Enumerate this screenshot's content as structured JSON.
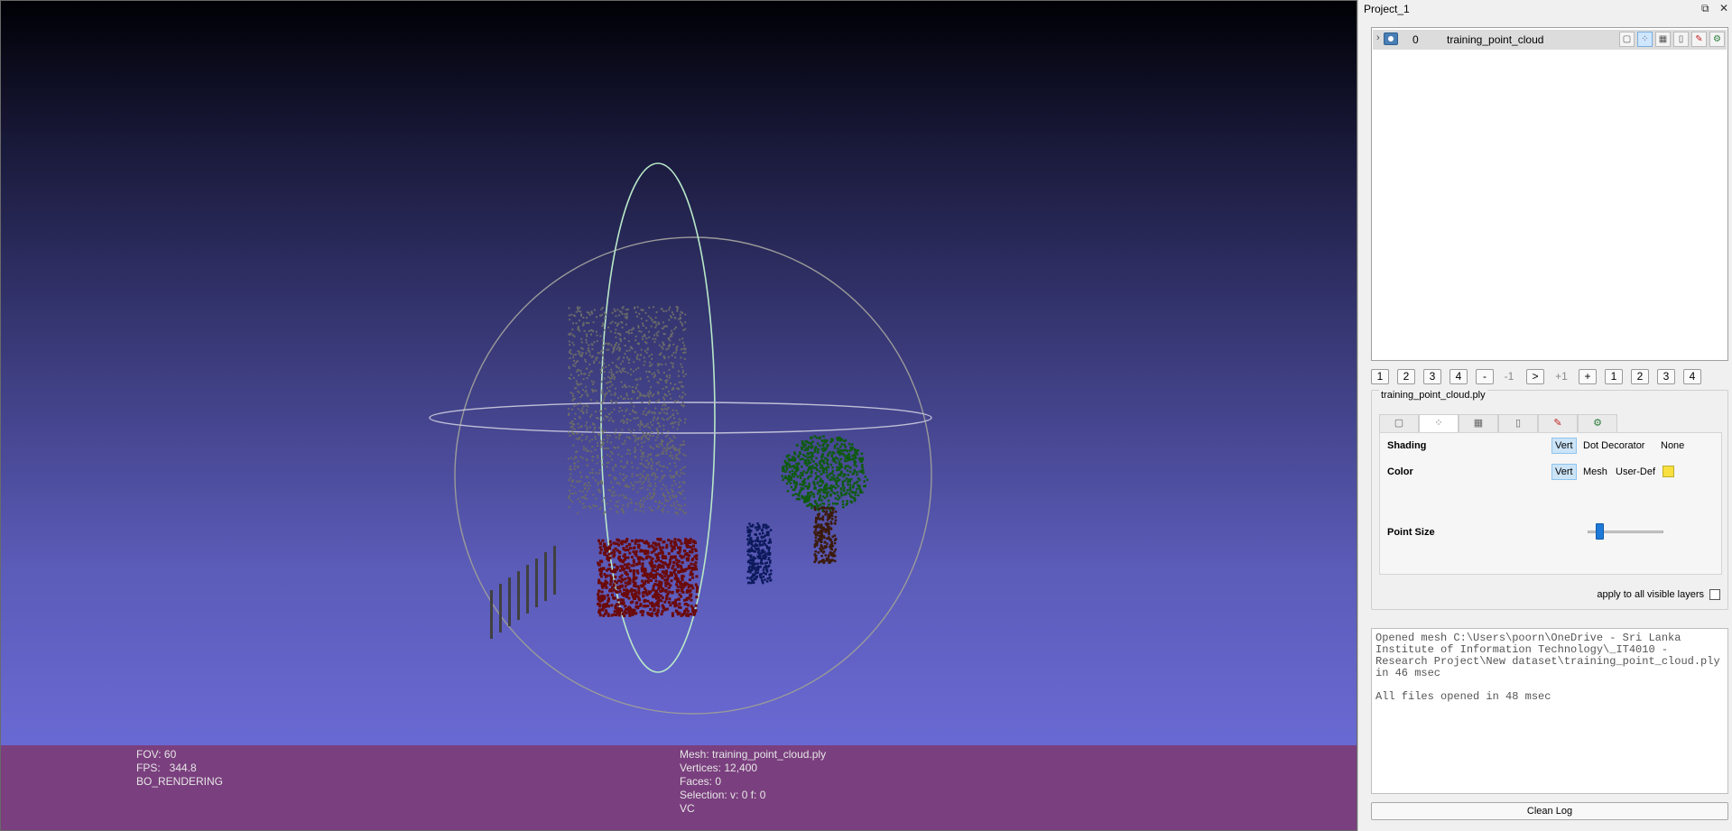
{
  "viewport": {
    "left_info": {
      "fov": "FOV: 60",
      "fps": "FPS:   344.8",
      "mode": "BO_RENDERING"
    },
    "right_info": {
      "mesh": "Mesh: training_point_cloud.ply",
      "vertices": "Vertices: 12,400",
      "faces": "Faces: 0",
      "selection": "Selection: v: 0 f: 0",
      "vc": "VC"
    },
    "colors": {
      "grey_cloud": "#6a6a6a",
      "red_cloud": "#6a0a0a",
      "tree_leaves": "#0f5a10",
      "tree_trunk": "#3b1a0a",
      "blue_box": "#0c1a5c",
      "fence": "#404040",
      "trackball": "#9a9a9a",
      "trackball_ring": "#b8e8c8"
    }
  },
  "panel": {
    "title": "Project_1",
    "title_buttons": [
      "⧉",
      "✕"
    ],
    "layers": [
      {
        "index": "0",
        "name": "training_point_cloud"
      }
    ],
    "layer_icons": [
      "box-icon",
      "points-icon",
      "wire-icon",
      "texture-icon",
      "brush-icon",
      "settings-icon"
    ],
    "paging": [
      "1",
      "2",
      "3",
      "4",
      "-",
      "-1",
      ">",
      "+1",
      "+",
      "1",
      "2",
      "3",
      "4"
    ],
    "properties": {
      "file": "training_point_cloud.ply",
      "shading_label": "Shading",
      "shading_options": [
        "Vert",
        "Dot Decorator",
        "None"
      ],
      "shading_selected": "Vert",
      "color_label": "Color",
      "color_options": [
        "Vert",
        "Mesh",
        "User-Def"
      ],
      "color_selected": "Vert",
      "user_def_color": "#f7e040",
      "point_size_label": "Point Size",
      "point_size_value_fraction": 0.15,
      "apply_all_label": "apply to all visible layers"
    },
    "log": [
      "Opened mesh C:\\Users\\poorn\\OneDrive - Sri Lanka Institute of Information Technology\\_IT4010 - Research Project\\New dataset\\training_point_cloud.ply in 46 msec",
      "All files opened in 48 msec"
    ],
    "clean_log_label": "Clean Log"
  }
}
